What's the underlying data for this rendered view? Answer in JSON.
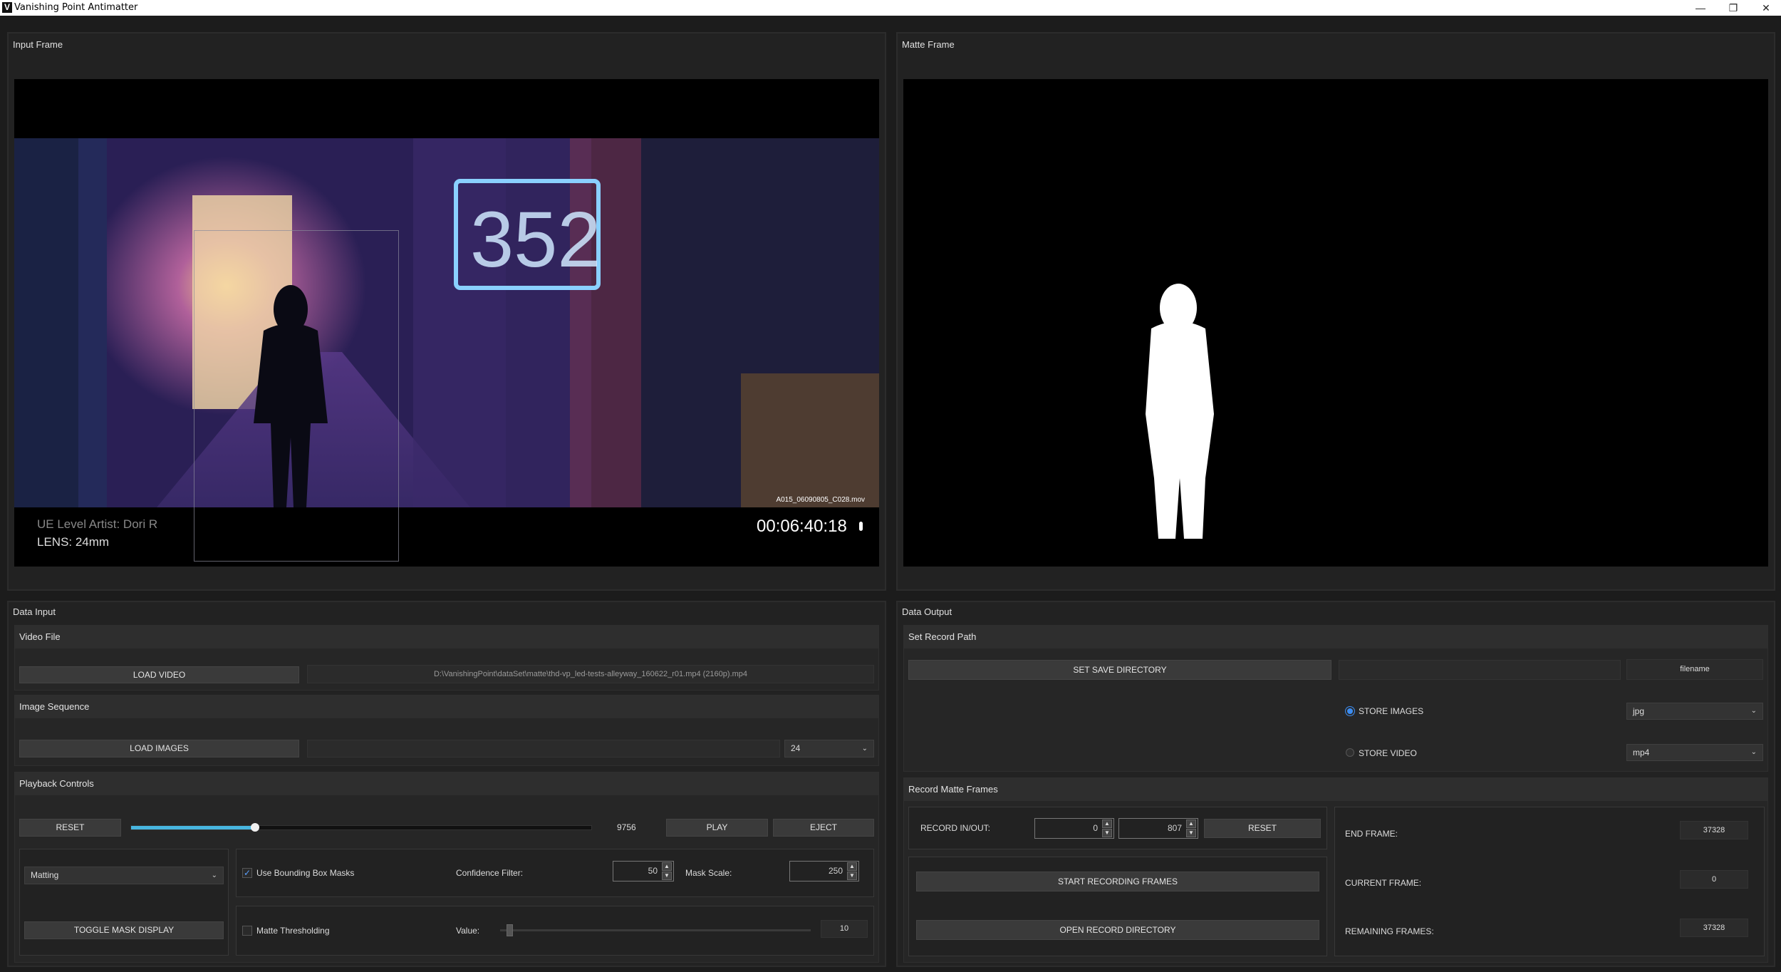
{
  "window": {
    "title": "Vanishing Point Antimatter",
    "app_icon": "V"
  },
  "input_frame": {
    "title": "Input Frame",
    "clip_name": "A015_06090805_C028.mov",
    "overlay_artist": "UE Level Artist: Dori R",
    "overlay_lens": "LENS: 24mm",
    "timecode": "00:06:40:18"
  },
  "matte_frame": {
    "title": "Matte Frame"
  },
  "data_input": {
    "title": "Data Input",
    "video_file": {
      "header": "Video File",
      "load_label": "LOAD VIDEO",
      "path": "D:\\VanishingPoint\\dataSet\\matte\\thd-vp_led-tests-alleyway_160622_r01.mp4 (2160p).mp4"
    },
    "image_sequence": {
      "header": "Image Sequence",
      "load_label": "LOAD IMAGES",
      "path": "",
      "fps": "24"
    },
    "playback": {
      "header": "Playback Controls",
      "reset_label": "RESET",
      "progress": 0.27,
      "frame": "9756",
      "play_label": "PLAY",
      "eject_label": "EJECT"
    },
    "mode": {
      "selected": "Matting",
      "toggle_label": "TOGGLE MASK DISPLAY"
    },
    "bbox": {
      "use_label": "Use Bounding Box Masks",
      "use_checked": true,
      "confidence_label": "Confidence Filter:",
      "confidence_value": "50",
      "scale_label": "Mask Scale:",
      "scale_value": "250"
    },
    "threshold": {
      "label": "Matte Thresholding",
      "checked": false,
      "value_label": "Value:",
      "slider": 0.02,
      "value": "10"
    }
  },
  "data_output": {
    "title": "Data Output",
    "record_path": {
      "header": "Set Record Path",
      "set_dir_label": "SET SAVE DIRECTORY",
      "dir_value": "",
      "filename": "filename",
      "store_images_label": "STORE IMAGES",
      "store_images_selected": true,
      "image_format": "jpg",
      "store_video_label": "STORE VIDEO",
      "video_format": "mp4"
    },
    "record": {
      "header": "Record Matte Frames",
      "inout_label": "RECORD IN/OUT:",
      "in_value": "0",
      "out_value": "807",
      "reset_label": "RESET",
      "start_label": "START RECORDING FRAMES",
      "open_label": "OPEN RECORD DIRECTORY",
      "end_frame_label": "END FRAME:",
      "end_frame": "37328",
      "current_frame_label": "CURRENT FRAME:",
      "current_frame": "0",
      "remaining_label": "REMAINING FRAMES:",
      "remaining": "37328"
    }
  },
  "icons": {
    "minimize": "minimize-icon",
    "restore": "restore-icon",
    "close": "close-icon",
    "spin_up": "chevron-up-icon",
    "spin_down": "chevron-down-icon"
  }
}
